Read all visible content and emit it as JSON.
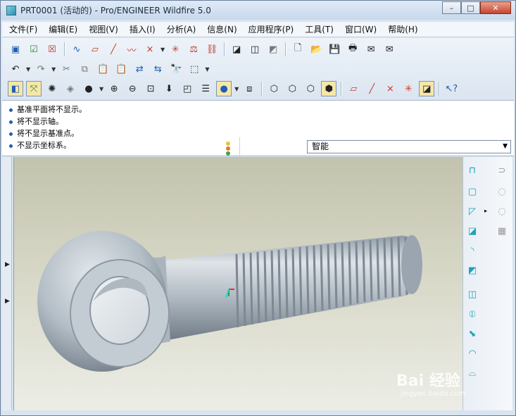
{
  "window": {
    "title": "PRT0001 (活动的) - Pro/ENGINEER Wildfire 5.0",
    "controls": {
      "minimize": "–",
      "maximize": "□",
      "close": "✕"
    }
  },
  "menubar": {
    "items": [
      "文件(F)",
      "编辑(E)",
      "视图(V)",
      "插入(I)",
      "分析(A)",
      "信息(N)",
      "应用程序(P)",
      "工具(T)",
      "窗口(W)",
      "帮助(H)"
    ]
  },
  "messages": {
    "lines": [
      "基准平面将不显示。",
      "将不显示轴。",
      "将不显示基准点。",
      "不显示坐标系。"
    ]
  },
  "filter": {
    "selected": "智能"
  },
  "watermark": {
    "text": "Bai 经验",
    "sub": "jingyan.baidu.com"
  },
  "colors": {
    "accent": "#1e5fb4",
    "titlebar": "#c7d8ec",
    "viewport_top": "#c2c3ad",
    "model": "#b3bcc3"
  }
}
